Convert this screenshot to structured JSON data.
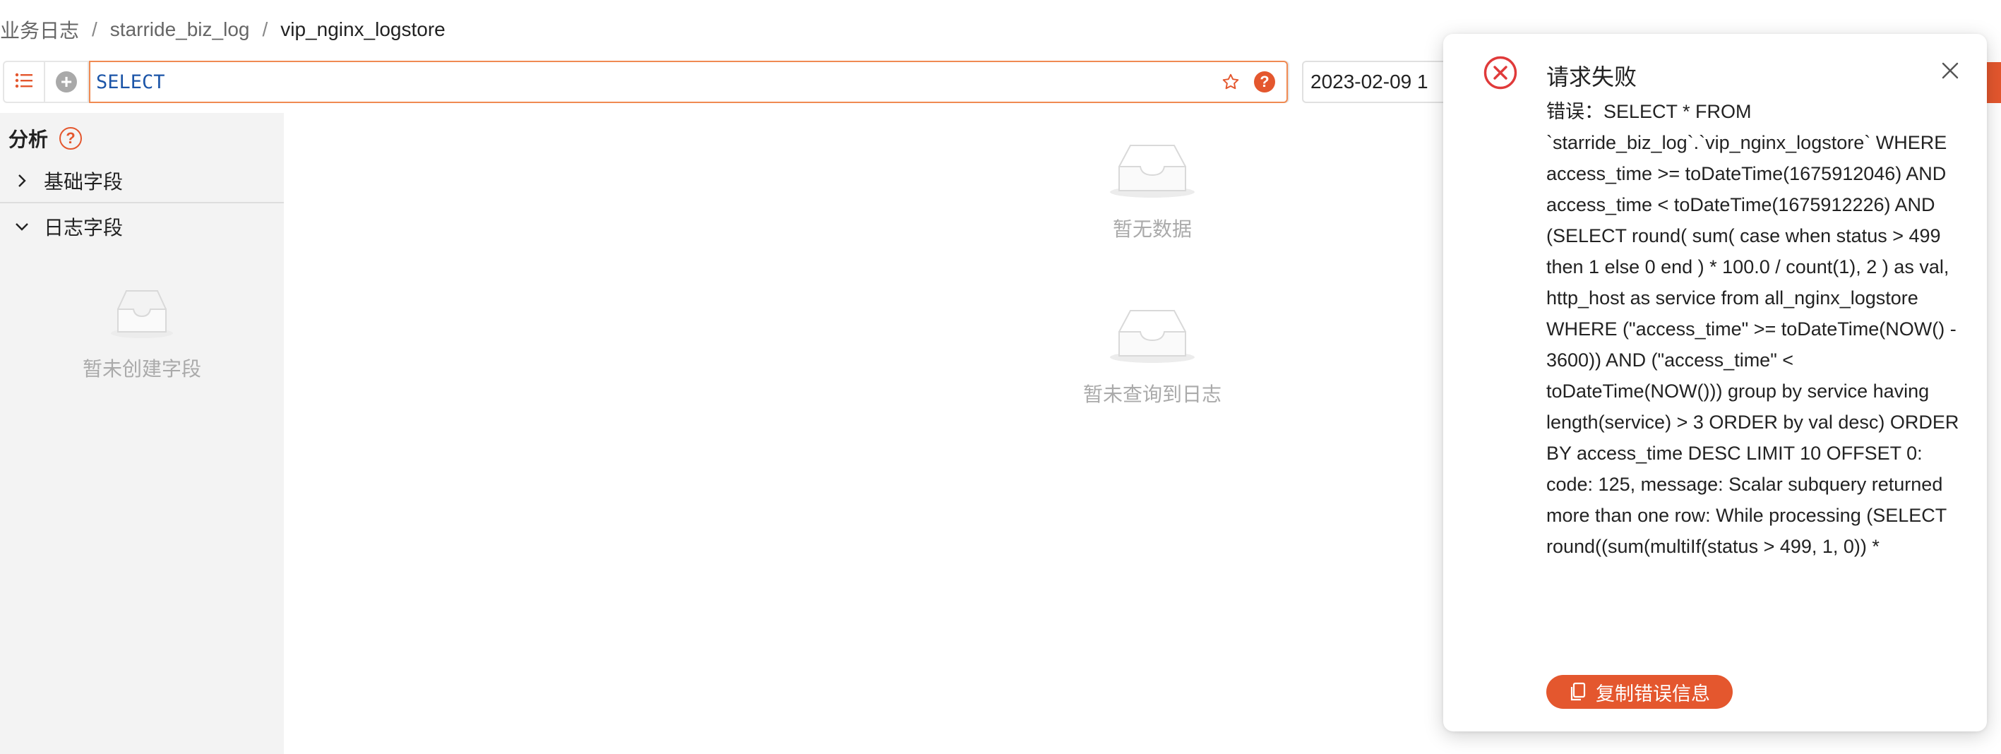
{
  "breadcrumb": {
    "items": [
      "业务日志",
      "starride_biz_log",
      "vip_nginx_logstore"
    ],
    "separator": "/"
  },
  "query": {
    "value": "SELECT",
    "icons": [
      "list-icon",
      "plus-circle-icon",
      "star-outline-icon",
      "help-icon"
    ]
  },
  "datetime": {
    "value": "2023-02-09 1"
  },
  "sidebar": {
    "analysis_label": "分析",
    "groups": [
      {
        "label": "基础字段",
        "expanded": false
      },
      {
        "label": "日志字段",
        "expanded": true
      }
    ],
    "empty_text": "暂未创建字段"
  },
  "main": {
    "empty_data_text": "暂无数据",
    "empty_logs_text": "暂未查询到日志"
  },
  "error_popover": {
    "title": "请求失败",
    "message": "错误：SELECT * FROM `starride_biz_log`.`vip_nginx_logstore` WHERE access_time >= toDateTime(1675912046) AND access_time < toDateTime(1675912226) AND (SELECT round( sum( case when status > 499 then 1 else 0 end ) * 100.0 / count(1), 2 ) as val, http_host as service from all_nginx_logstore WHERE (\"access_time\" >= toDateTime(NOW() - 3600)) AND (\"access_time\" < toDateTime(NOW())) group by service having length(service) > 3 ORDER by val desc) ORDER BY access_time DESC LIMIT 10 OFFSET 0: code: 125, message: Scalar subquery returned more than one row: While processing (SELECT round((sum(multiIf(status > 499, 1, 0)) *",
    "copy_button_label": "复制错误信息"
  },
  "colors": {
    "accent": "#e4572e",
    "error_red": "#e03a3a",
    "query_text": "#1c55a8",
    "sidebar_bg": "#f3f3f3"
  }
}
